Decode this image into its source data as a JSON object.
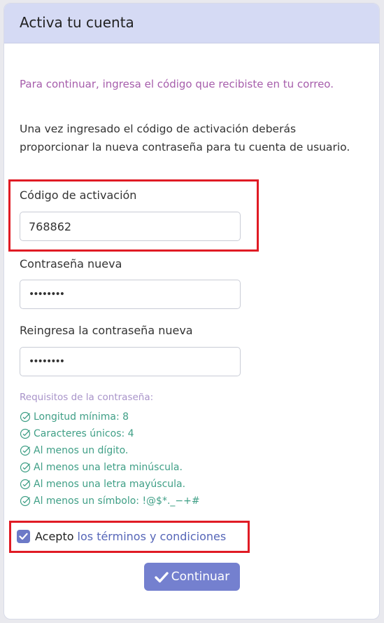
{
  "header": {
    "title": "Activa tu cuenta"
  },
  "intro": "Para continuar, ingresa el código que recibiste en tu correo.",
  "description": "Una vez ingresado el código de activación deberás proporcionar la nueva contraseña para tu cuenta de usuario.",
  "fields": {
    "code": {
      "label": "Código de activación",
      "value": "768862"
    },
    "new_password": {
      "label": "Contraseña nueva",
      "value": "••••••••"
    },
    "repeat_password": {
      "label": "Reingresa la contraseña nueva",
      "value": "••••••••"
    }
  },
  "requirements": {
    "title": "Requisitos de la contraseña:",
    "items": [
      "Longitud mínima: 8",
      "Caracteres únicos: 4",
      "Al menos un dígito.",
      "Al menos una letra minúscula.",
      "Al menos una letra mayúscula.",
      "Al menos un símbolo: !@$*._−+#"
    ]
  },
  "terms": {
    "accept_label": "Acepto",
    "link_label": "los términos y condiciones",
    "checked": true
  },
  "submit": {
    "label": "Continuar"
  },
  "colors": {
    "header_bg": "#d5daf4",
    "accent": "#7480cf",
    "intro_text": "#a65dab",
    "requirement_ok": "#3f9f86",
    "highlight": "#e01b24"
  },
  "icons": {
    "requirement": "check-circle-icon",
    "checkbox": "checkmark-icon",
    "submit": "checkmark-icon"
  }
}
